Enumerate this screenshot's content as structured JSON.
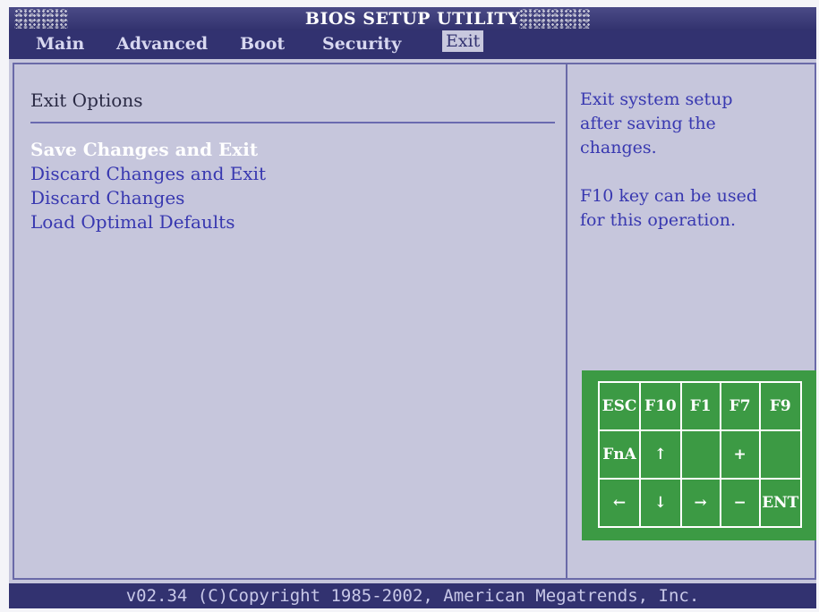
{
  "title": "BIOS SETUP UTILITY",
  "menu": [
    {
      "label": "Main"
    },
    {
      "label": "Advanced"
    },
    {
      "label": "Boot"
    },
    {
      "label": "Security"
    },
    {
      "label": "Exit",
      "active": true
    }
  ],
  "section": {
    "title": "Exit Options",
    "options": [
      {
        "label": "Save Changes and Exit",
        "selected": true
      },
      {
        "label": "Discard Changes and Exit"
      },
      {
        "label": "Discard Changes"
      },
      {
        "label": "Load Optimal Defaults"
      }
    ]
  },
  "help": {
    "line1": "Exit system setup\nafter saving the\nchanges.",
    "line2": "F10 key can be used\nfor this operation."
  },
  "keypad": {
    "rows": [
      [
        "ESC",
        "F10",
        "F1",
        "F7",
        "F9"
      ],
      [
        "FnA",
        "↑",
        "",
        "+",
        ""
      ],
      [
        "←",
        "↓",
        "→",
        "−",
        "ENT"
      ]
    ]
  },
  "footer": "v02.34 (C)Copyright 1985-2002, American Megatrends, Inc.",
  "colors": {
    "background": "#c6c6dc",
    "bar": "#323270",
    "option_text": "#3838b0",
    "selected_text": "#ffffff",
    "keypad": "#3c9a44"
  }
}
